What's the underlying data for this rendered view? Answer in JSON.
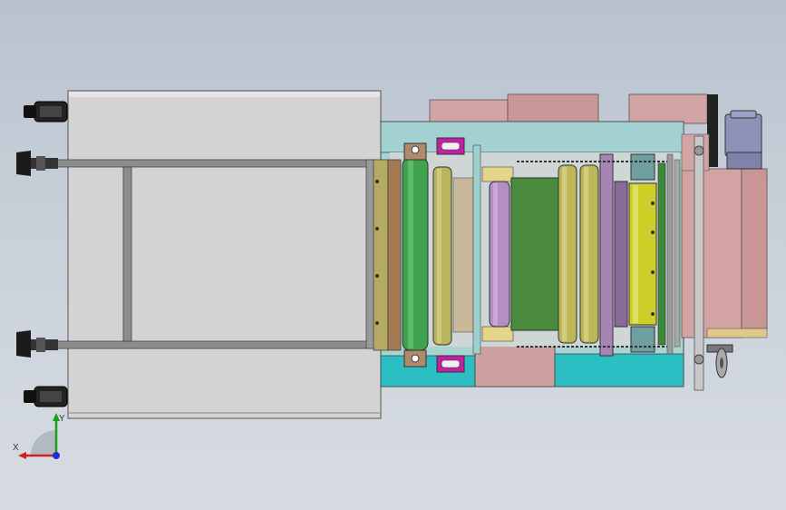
{
  "viewport": {
    "background_top": "#b8c2ce",
    "background_bottom": "#d7dce2",
    "model_colors": {
      "table_plate": "#d6d6d6",
      "frame_rail": "#8a8a8a",
      "teal_body": "#a9d3d3",
      "cyan_body": "#2fbfc2",
      "pink_block": "#d3a3a3",
      "green_roller": "#3fa34d",
      "olive_roller": "#b8b458",
      "yellow_roller": "#cfcf2a",
      "violet_roller": "#b38bc2",
      "green_belt": "#4e8a3f",
      "magenta_clamp": "#c51fa5",
      "motor": "#8f93b8"
    }
  },
  "triad": {
    "x_label": "X",
    "y_label": "Y",
    "x_color": "#d02020",
    "y_color": "#18a018",
    "z_color": "#2030d0"
  }
}
